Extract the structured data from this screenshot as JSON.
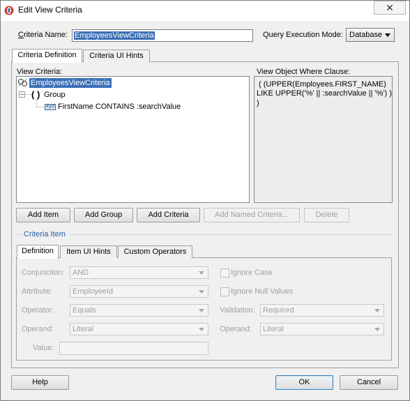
{
  "window": {
    "title": "Edit View Criteria",
    "close_glyph": "✕"
  },
  "criteria_name": {
    "label": "Criteria Name:",
    "value": "EmployeesViewCriteria"
  },
  "query_mode": {
    "label": "Query Execution Mode:",
    "value": "Database"
  },
  "main_tabs": [
    {
      "label": "Criteria Definition",
      "active": true
    },
    {
      "label": "Criteria UI Hints",
      "active": false
    }
  ],
  "view_criteria": {
    "label": "View Criteria:",
    "tree": {
      "root": "EmployeesViewCriteria",
      "group_glyph": "( )",
      "group": "Group",
      "field_badge": "xyz",
      "condition": "FirstName CONTAINS :searchValue"
    }
  },
  "where_clause": {
    "label": "View Object Where Clause:",
    "lines": [
      "( (UPPER(Employees.FIRST_NAME)",
      "LIKE UPPER('%' || :searchValue || '%') )",
      ")"
    ]
  },
  "action_buttons": {
    "add_item": "Add Item",
    "add_group": "Add Group",
    "add_criteria": "Add Criteria",
    "add_named_criteria": "Add Named Criteria...",
    "delete": "Delete"
  },
  "criteria_item": {
    "label": "Criteria Item",
    "tabs": [
      {
        "label": "Definition",
        "active": true
      },
      {
        "label": "Item UI Hints",
        "active": false
      },
      {
        "label": "Custom Operators",
        "active": false
      }
    ],
    "conjunction": {
      "label": "Conjunction:",
      "value": "AND"
    },
    "attribute": {
      "label": "Attribute:",
      "value": "EmployeeId"
    },
    "operator": {
      "label": "Operator:",
      "value": "Equals"
    },
    "operand": {
      "label": "Operand:",
      "value": "Literal"
    },
    "value": {
      "label": "Value:",
      "value": ""
    },
    "ignore_case": {
      "label": "Ignore Case",
      "checked": false
    },
    "ignore_nulls": {
      "label": "Ignore Null Values",
      "checked": false
    },
    "validation": {
      "label": "Validation:",
      "value": "Required"
    },
    "operand2": {
      "label": "Operand:",
      "value": "Literal"
    }
  },
  "footer": {
    "help": "Help",
    "ok": "OK",
    "cancel": "Cancel"
  },
  "colors": {
    "selection": "#3b6fb6",
    "title_bg": "#ffffff",
    "dialog_bg": "#f0f0f0",
    "accent_icon": "#d4372c"
  }
}
